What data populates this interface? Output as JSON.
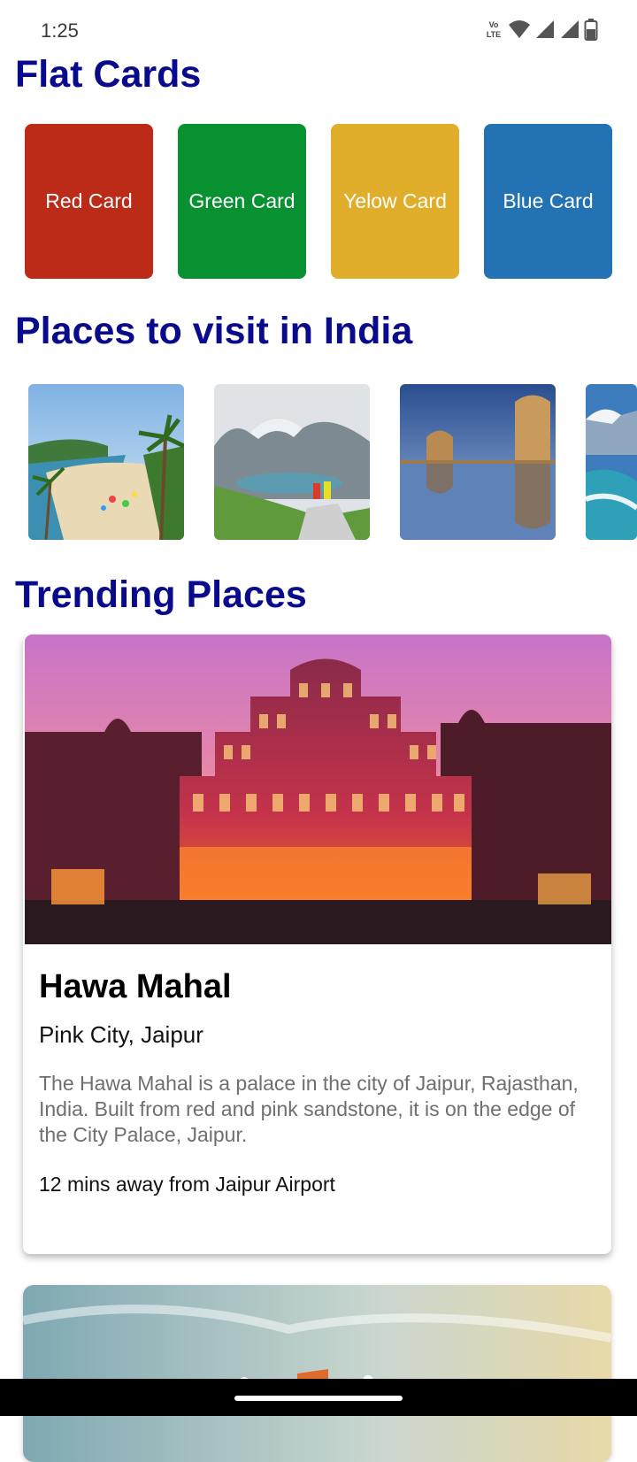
{
  "status_bar": {
    "time": "1:25",
    "icons": [
      "volte-icon",
      "wifi-icon",
      "signal-icon",
      "signal-icon",
      "battery-icon"
    ]
  },
  "flat_cards": {
    "title": "Flat Cards",
    "cards": [
      {
        "label": "Red Card",
        "color": "#bb2b17"
      },
      {
        "label": "Green Card",
        "color": "#089131"
      },
      {
        "label": "Yelow Card",
        "color": "#e0ae2a"
      },
      {
        "label": "Blue Card",
        "color": "#2272b4"
      }
    ]
  },
  "places": {
    "title": "Places to visit in India",
    "thumbnails": [
      "beach-photo",
      "mountain-lake-photo",
      "desert-fort-photo",
      "snow-coast-photo"
    ]
  },
  "trending": {
    "title": "Trending Places",
    "cards": [
      {
        "name": "Hawa Mahal",
        "location": "Pink City, Jaipur",
        "description": "The Hawa Mahal is a palace in the city of Jaipur, Rajasthan, India. Built from red and pink sandstone, it is on the edge of the City Palace, Jaipur.",
        "distance": "12 mins away from Jaipur Airport"
      }
    ]
  }
}
